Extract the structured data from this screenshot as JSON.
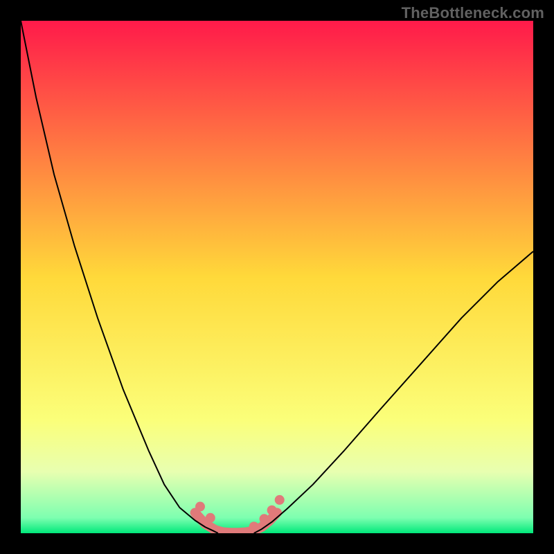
{
  "watermark": "TheBottleneck.com",
  "chart_data": {
    "type": "line",
    "title": "",
    "xlabel": "",
    "ylabel": "",
    "xlim": [
      0,
      100
    ],
    "ylim": [
      0,
      100
    ],
    "grid": false,
    "legend": false,
    "background_gradient": {
      "stops": [
        {
          "offset": 0.0,
          "color": "#ff1a4a"
        },
        {
          "offset": 0.5,
          "color": "#ffd93a"
        },
        {
          "offset": 0.78,
          "color": "#fbff7a"
        },
        {
          "offset": 0.88,
          "color": "#e8ffb0"
        },
        {
          "offset": 0.97,
          "color": "#7dffb0"
        },
        {
          "offset": 1.0,
          "color": "#00e87a"
        }
      ]
    },
    "series": [
      {
        "name": "left-arm",
        "type": "line",
        "x": [
          0.0,
          3.0,
          6.5,
          10.5,
          15.0,
          20.0,
          25.0,
          28.0,
          31.0,
          34.0,
          36.0,
          37.5,
          38.5
        ],
        "y": [
          100.0,
          85.0,
          70.0,
          56.0,
          42.0,
          28.0,
          16.0,
          9.5,
          5.0,
          2.5,
          1.2,
          0.5,
          0.0
        ],
        "stroke": "#000000",
        "width": 2
      },
      {
        "name": "right-arm",
        "type": "line",
        "x": [
          45.5,
          47.0,
          49.0,
          52.0,
          57.0,
          63.0,
          70.0,
          78.0,
          86.0,
          93.0,
          100.0
        ],
        "y": [
          0.0,
          0.8,
          2.2,
          4.8,
          9.5,
          16.0,
          24.0,
          33.0,
          42.0,
          49.0,
          55.0
        ],
        "stroke": "#000000",
        "width": 2
      },
      {
        "name": "valley-band",
        "type": "line",
        "x": [
          34.0,
          36.0,
          38.0,
          39.5,
          41.0,
          42.5,
          44.0,
          45.5,
          47.0,
          48.5,
          50.0
        ],
        "y": [
          4.0,
          1.8,
          0.6,
          0.2,
          0.1,
          0.1,
          0.2,
          0.5,
          1.2,
          2.4,
          4.0
        ],
        "stroke": "#e07a7a",
        "width": 14,
        "cap": "round"
      },
      {
        "name": "valley-dots",
        "type": "scatter",
        "x": [
          35.0,
          37.0,
          45.5,
          47.5,
          49.0,
          50.5
        ],
        "y": [
          5.2,
          3.0,
          1.3,
          2.8,
          4.5,
          6.5
        ],
        "stroke": "#e07a7a",
        "radius": 7
      }
    ]
  }
}
